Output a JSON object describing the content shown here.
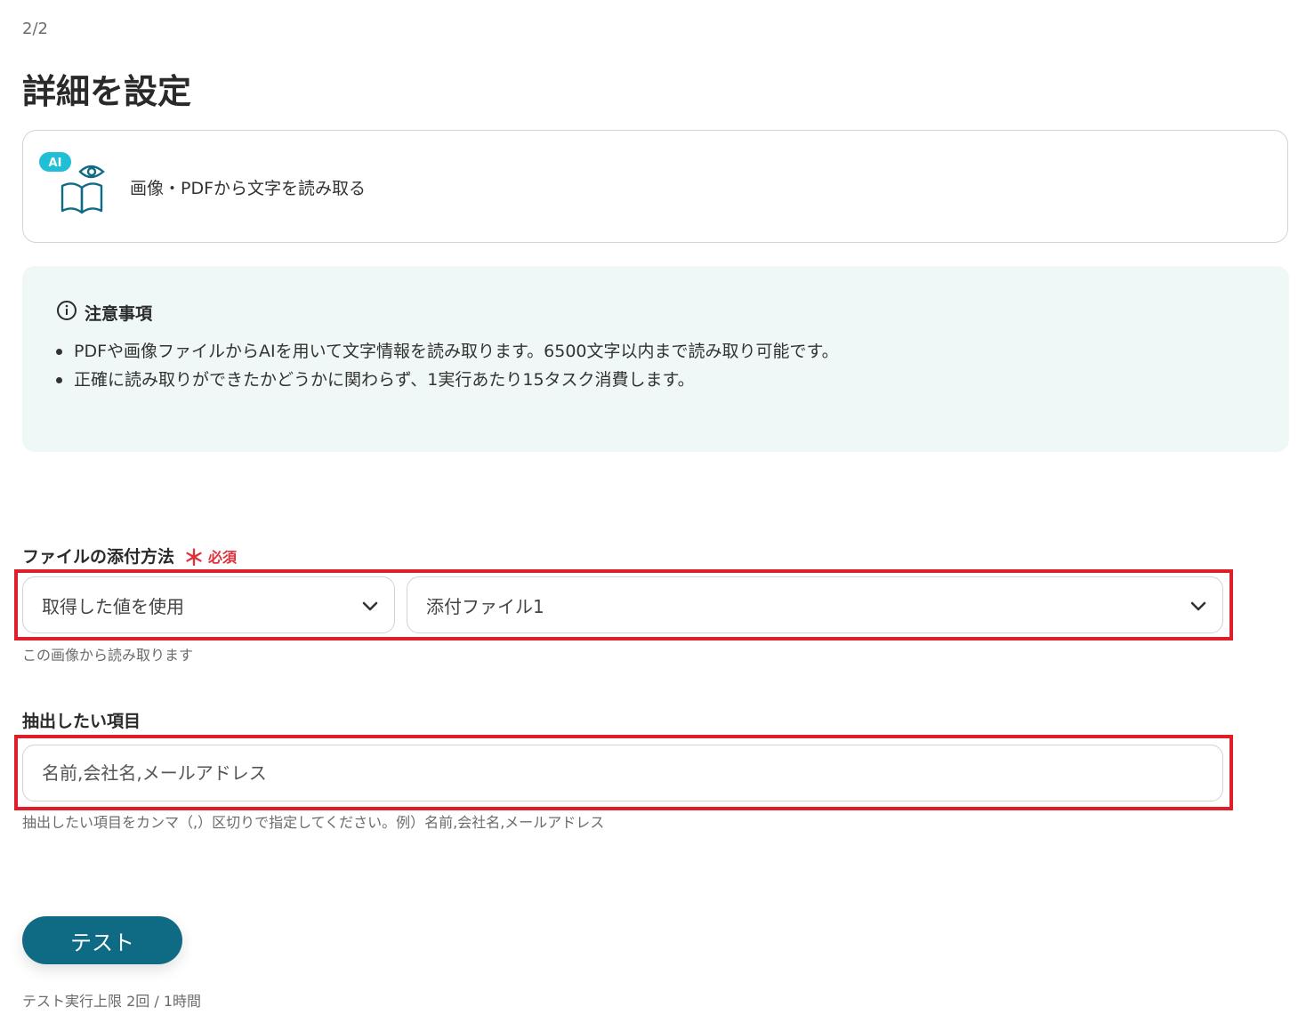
{
  "header": {
    "step": "2/2",
    "title": "詳細を設定"
  },
  "action": {
    "badge": "AI",
    "label": "画像・PDFから文字を読み取る",
    "icon": "ai-book-eye-icon"
  },
  "notice": {
    "icon": "info-icon",
    "title": "注意事項",
    "items": [
      "PDFや画像ファイルからAIを用いて文字情報を読み取ります。6500文字以内まで読み取り可能です。",
      "正確に読み取りができたかどうかに関わらず、1実行あたり15タスク消費します。"
    ]
  },
  "file_method": {
    "label": "ファイルの添付方法",
    "required_mark": "＊",
    "required_text": "必須",
    "select_mode": "取得した値を使用",
    "select_file": "添付ファイル1",
    "help": "この画像から読み取ります"
  },
  "extract": {
    "label": "抽出したい項目",
    "placeholder": "名前,会社名,メールアドレス",
    "help": "抽出したい項目をカンマ（,）区切りで指定してください。例）名前,会社名,メールアドレス"
  },
  "test": {
    "button_label": "テスト",
    "limit": "テスト実行上限 2回 / 1時間"
  },
  "colors": {
    "accent": "#0f6b84",
    "highlight": "#e01e2a",
    "required": "#e0303a",
    "notice_bg": "#eff8f6",
    "ai_badge": "#1fbfd6"
  }
}
